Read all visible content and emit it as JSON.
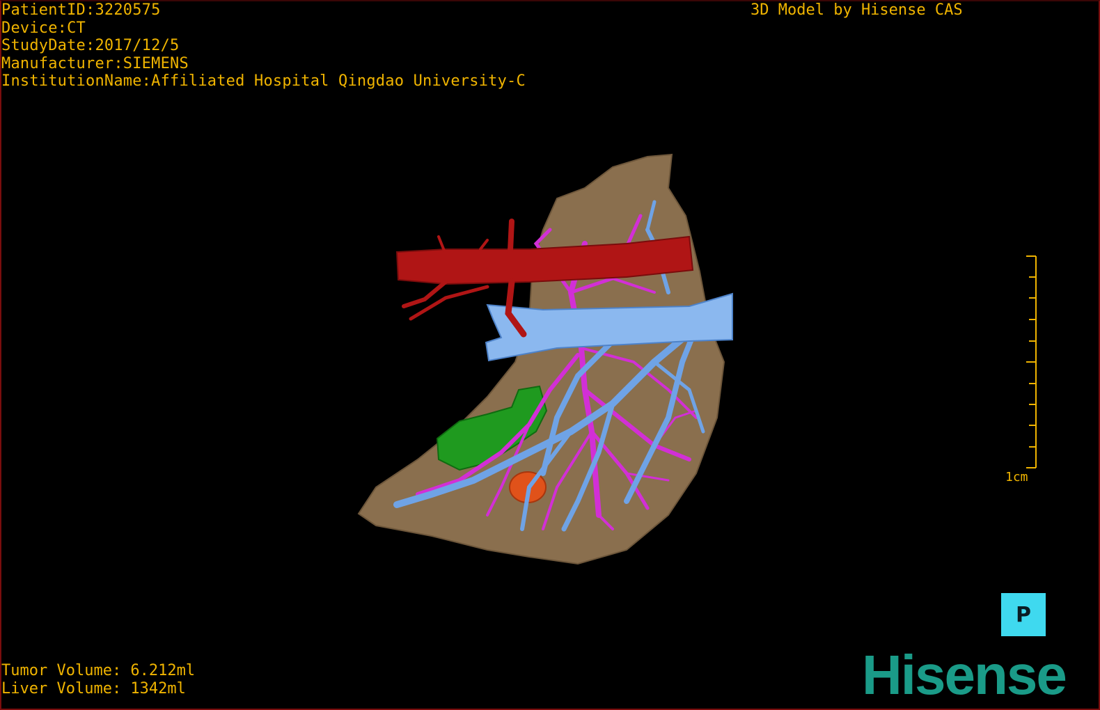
{
  "header": {
    "patient_id": "PatientID:3220575",
    "device": "Device:CT",
    "study_date": "StudyDate:2017/12/5",
    "manufacturer": "Manufacturer:SIEMENS",
    "institution": "InstitutionName:Affiliated Hospital Qingdao University-C",
    "model_credit": "3D Model by Hisense CAS"
  },
  "volumes": {
    "tumor": "Tumor Volume: 6.212ml",
    "liver": "Liver Volume: 1342ml"
  },
  "scale_bar": {
    "label": "1cm"
  },
  "orientation_cube": {
    "label": "P"
  },
  "brand": {
    "logo_text": "Hisense"
  },
  "colors": {
    "text": "#f0b400",
    "liver": "#8a6f4e",
    "artery": "#b01515",
    "portal_vein": "#6fa3e6",
    "hepatic_vein": "#d22fd6",
    "gallbladder": "#1f9a1f",
    "tumor": "#e0521a",
    "orientation_bg": "#3fd9ef",
    "logo": "#1a9b88"
  }
}
